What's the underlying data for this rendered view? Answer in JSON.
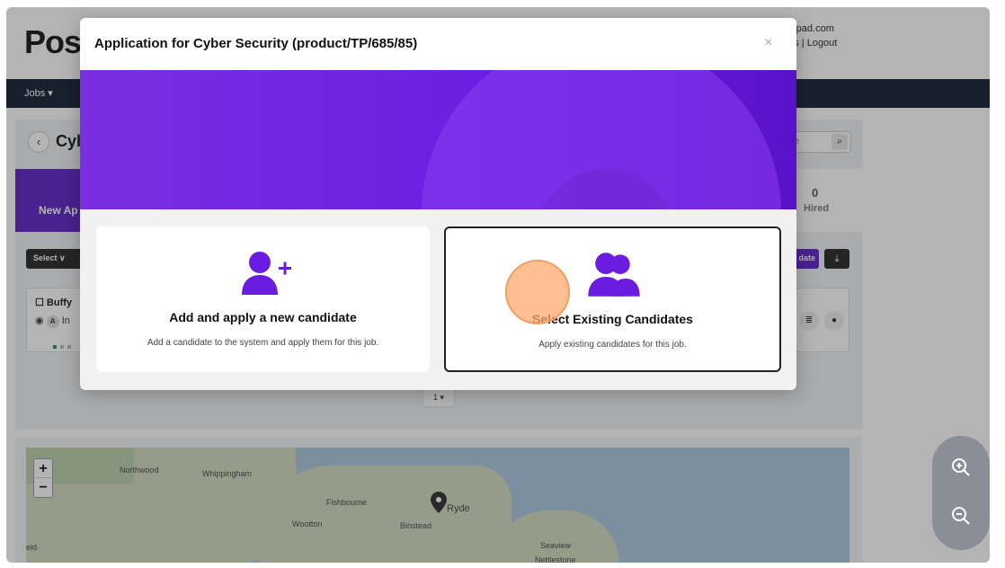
{
  "app": {
    "logo_text": "Posi",
    "user_email_partial": "ibepad.com",
    "user_links_partial": "ngs | Logout",
    "nav_jobs": "Jobs ▾"
  },
  "page": {
    "title_partial": "Cyb",
    "search_placeholder_partial": "ne",
    "stage_new_label_partial": "New Ap",
    "hired_count": "0",
    "hired_label": "Hired",
    "select_label": "Select ∨",
    "add_candidate_label_partial": "date",
    "candidate_name_partial": "Buffy",
    "pagination_value": "1 ▾"
  },
  "modal": {
    "title": "Application for Cyber Security (product/TP/685/85)",
    "close_symbol": "×",
    "options": [
      {
        "title": "Add and apply a new candidate",
        "description": "Add a candidate to the system and apply them for this job.",
        "icon": "user-plus-icon"
      },
      {
        "title": "Select Existing Candidates",
        "description": "Apply existing candidates for this job.",
        "icon": "users-icon"
      }
    ]
  },
  "map": {
    "labels": [
      "Northwood",
      "Whippingham",
      "Fishbourne",
      "Wootton",
      "Binstead",
      "Ryde",
      "Seaview",
      "Nettlestone",
      "eld"
    ],
    "zoom_in": "+",
    "zoom_out": "−"
  },
  "colors": {
    "accent": "#6a1de0",
    "navbar": "#0f1c2e"
  }
}
